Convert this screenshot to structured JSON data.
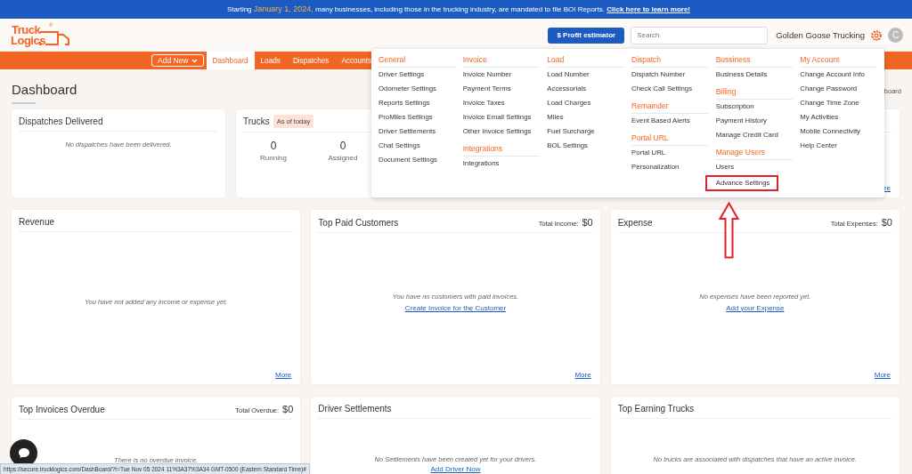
{
  "announcement": {
    "before": "Starting ",
    "highlight": "January 1, 2024,",
    "after": " many businesses, including those in the trucking industry, are mandated to file BOI Reports. ",
    "link": "Click here to learn more!"
  },
  "brand": {
    "lines": [
      "Truck",
      "Logics"
    ],
    "mark": "®"
  },
  "header": {
    "profit_button": "$ Profit estimator",
    "search": {
      "placeholder": "Search"
    },
    "company": "Golden Goose Trucking",
    "avatar": "C"
  },
  "nav": {
    "add_new": "Add New",
    "tabs": [
      {
        "label": "Dashboard",
        "selected": true
      },
      {
        "label": "Loads",
        "selected": false
      },
      {
        "label": "Dispatches",
        "selected": false
      },
      {
        "label": "Accounts",
        "selected": false
      }
    ]
  },
  "page": {
    "title": "Dashboard",
    "breadcrumb": "board"
  },
  "settings_menu": {
    "columns": [
      [
        {
          "title": "General",
          "items": [
            {
              "label": "Driver Settings",
              "highlighted": false
            },
            {
              "label": "Odometer Settings",
              "highlighted": false
            },
            {
              "label": "Reports Settings",
              "highlighted": false
            },
            {
              "label": "ProMiles Settings",
              "highlighted": false
            },
            {
              "label": "Driver Settlements",
              "highlighted": false
            },
            {
              "label": "Chat Settings",
              "highlighted": false
            },
            {
              "label": "Document Settings",
              "highlighted": false
            }
          ]
        }
      ],
      [
        {
          "title": "Invoice",
          "items": [
            {
              "label": "Invoice Number",
              "highlighted": false
            },
            {
              "label": "Payment Terms",
              "highlighted": false
            },
            {
              "label": "Invoice Taxes",
              "highlighted": false
            },
            {
              "label": "Invoice Email Settings",
              "highlighted": false
            },
            {
              "label": "Other Invoice Settings",
              "highlighted": false
            }
          ]
        },
        {
          "title": "Integrations",
          "items": [
            {
              "label": "Integrations",
              "highlighted": false
            }
          ]
        }
      ],
      [
        {
          "title": "Load",
          "items": [
            {
              "label": "Load Number",
              "highlighted": false
            },
            {
              "label": "Accessorials",
              "highlighted": false
            },
            {
              "label": "Load Charges",
              "highlighted": false
            },
            {
              "label": "Miles",
              "highlighted": false
            },
            {
              "label": "Fuel Surcharge",
              "highlighted": false
            },
            {
              "label": "BOL Settings",
              "highlighted": false
            }
          ]
        }
      ],
      [
        {
          "title": "Dispatch",
          "items": [
            {
              "label": "Dispatch Number",
              "highlighted": false
            },
            {
              "label": "Check Call Settings",
              "highlighted": false
            }
          ]
        },
        {
          "title": "Remainder",
          "items": [
            {
              "label": "Event Based Alerts",
              "highlighted": false
            }
          ]
        },
        {
          "title": "Portal URL",
          "items": [
            {
              "label": "Portal URL",
              "highlighted": false
            },
            {
              "label": "Personalization",
              "highlighted": false
            }
          ]
        }
      ],
      [
        {
          "title": "Bussiness",
          "items": [
            {
              "label": "Business Details",
              "highlighted": false
            }
          ]
        },
        {
          "title": "Billing",
          "items": [
            {
              "label": "Subscription",
              "highlighted": false
            },
            {
              "label": "Payment History",
              "highlighted": false
            },
            {
              "label": "Manage Credit Card",
              "highlighted": false
            }
          ]
        },
        {
          "title": "Manage Users",
          "items": [
            {
              "label": "Users",
              "highlighted": false
            },
            {
              "label": "Advance Settings",
              "highlighted": true
            }
          ]
        }
      ],
      [
        {
          "title": "My Account",
          "items": [
            {
              "label": "Change Account Info",
              "highlighted": false
            },
            {
              "label": "Change Password",
              "highlighted": false
            },
            {
              "label": "Change Time Zone",
              "highlighted": false
            },
            {
              "label": "My Activities",
              "highlighted": false
            },
            {
              "label": "Mobile Connectivity",
              "highlighted": false
            },
            {
              "label": "Help Center",
              "highlighted": false
            }
          ]
        }
      ]
    ]
  },
  "rows": [
    [
      {
        "kind": "message",
        "title": "Dispatches Delivered",
        "message": "No dispatches have been delivered."
      },
      {
        "kind": "stats",
        "title": "Trucks",
        "badge": "As of today",
        "stats": [
          {
            "value": "0",
            "label": "Running"
          },
          {
            "value": "0",
            "label": "Assigned"
          }
        ],
        "more": "re"
      }
    ],
    [
      {
        "kind": "message",
        "title": "Revenue",
        "message": "You have not added any income or expense yet.",
        "more": "More"
      },
      {
        "kind": "message",
        "title": "Top Paid Customers",
        "total_label": "Total Income:",
        "total_value": "$0",
        "message": "You have no customers with paid invoices.",
        "link": "Create Invoice for the Customer",
        "more": "More"
      },
      {
        "kind": "message",
        "title": "Expense",
        "total_label": "Total Expenses:",
        "total_value": "$0",
        "message": "No expenses have been reported yet.",
        "link": "Add your Expense",
        "more": "More"
      }
    ],
    [
      {
        "kind": "message",
        "title": "Top Invoices Overdue",
        "total_label": "Total Overdue:",
        "total_value": "$0",
        "message": "There is no overdue invoice."
      },
      {
        "kind": "message",
        "title": "Driver Settlements",
        "message": "No Settlements have been created yet for your drivers.",
        "link": "Add Driver Now"
      },
      {
        "kind": "message",
        "title": "Top Earning Trucks",
        "message": "No trucks are associated with dispatches that have an active invoice."
      }
    ]
  ],
  "status_bar": {
    "url": "https://secure.trucklogics.com/DashBoard/?t=Tue Nov 05 2024 11%3A37%3A34 GMT-0500 (Eastern Standard Time)#"
  }
}
